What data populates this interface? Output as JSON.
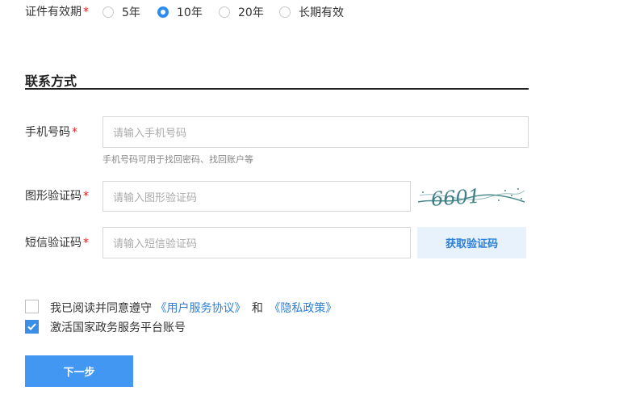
{
  "validity": {
    "label": "证件有效期",
    "required_mark": "*",
    "options": [
      "5年",
      "10年",
      "20年",
      "长期有效"
    ],
    "selected": "10年"
  },
  "contact": {
    "title": "联系方式"
  },
  "phone": {
    "label": "手机号码",
    "required_mark": "*",
    "placeholder": "请输入手机号码",
    "hint": "手机号码可用于找回密码、找回账户等"
  },
  "image_code": {
    "label": "图形验证码",
    "required_mark": "*",
    "placeholder": "请输入图形验证码",
    "captcha_text": "6601"
  },
  "sms_code": {
    "label": "短信验证码",
    "required_mark": "*",
    "placeholder": "请输入短信验证码",
    "button": "获取验证码"
  },
  "agreement": {
    "prefix": "我已阅读并同意遵守",
    "user_agreement": "《用户服务协议》",
    "and": "和",
    "privacy_policy": "《隐私政策》",
    "checked": false
  },
  "activate": {
    "label": "激活国家政务服务平台账号",
    "checked": true
  },
  "next_button": "下一步",
  "colors": {
    "accent": "#2d8cf0",
    "required": "#e02020",
    "button": "#4197f2"
  }
}
